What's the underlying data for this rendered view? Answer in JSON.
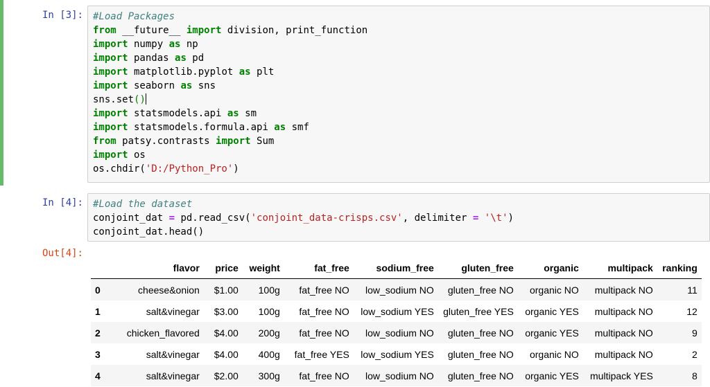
{
  "cell3": {
    "prompt": "In [3]:",
    "lines": [
      "#Load Packages",
      "from __future__ import division, print_function",
      "import numpy as np",
      "import pandas as pd",
      "import matplotlib.pyplot as plt",
      "import seaborn as sns",
      "sns.set()",
      "import statsmodels.api as sm",
      "import statsmodels.formula.api as smf",
      "from patsy.contrasts import Sum",
      "import os",
      "os.chdir('D:/Python_Pro')"
    ]
  },
  "cell4": {
    "prompt": "In [4]:",
    "lines": [
      "#Load the dataset",
      "conjoint_dat = pd.read_csv('conjoint_data-crisps.csv', delimiter = '\\t')",
      "conjoint_dat.head()"
    ],
    "out_prompt": "Out[4]:"
  },
  "table": {
    "columns": [
      "",
      "flavor",
      "price",
      "weight",
      "fat_free",
      "sodium_free",
      "gluten_free",
      "organic",
      "multipack",
      "ranking"
    ],
    "rows": [
      [
        "0",
        "cheese&onion",
        "$1.00",
        "100g",
        "fat_free NO",
        "low_sodium NO",
        "gluten_free NO",
        "organic NO",
        "multipack NO",
        "11"
      ],
      [
        "1",
        "salt&vinegar",
        "$3.00",
        "100g",
        "fat_free NO",
        "low_sodium YES",
        "gluten_free YES",
        "organic YES",
        "multipack NO",
        "12"
      ],
      [
        "2",
        "chicken_flavored",
        "$4.00",
        "200g",
        "fat_free NO",
        "low_sodium NO",
        "gluten_free NO",
        "organic YES",
        "multipack NO",
        "9"
      ],
      [
        "3",
        "salt&vinegar",
        "$4.00",
        "400g",
        "fat_free YES",
        "low_sodium YES",
        "gluten_free NO",
        "organic NO",
        "multipack NO",
        "2"
      ],
      [
        "4",
        "salt&vinegar",
        "$2.00",
        "300g",
        "fat_free NO",
        "low_sodium NO",
        "gluten_free NO",
        "organic YES",
        "multipack YES",
        "8"
      ]
    ]
  }
}
